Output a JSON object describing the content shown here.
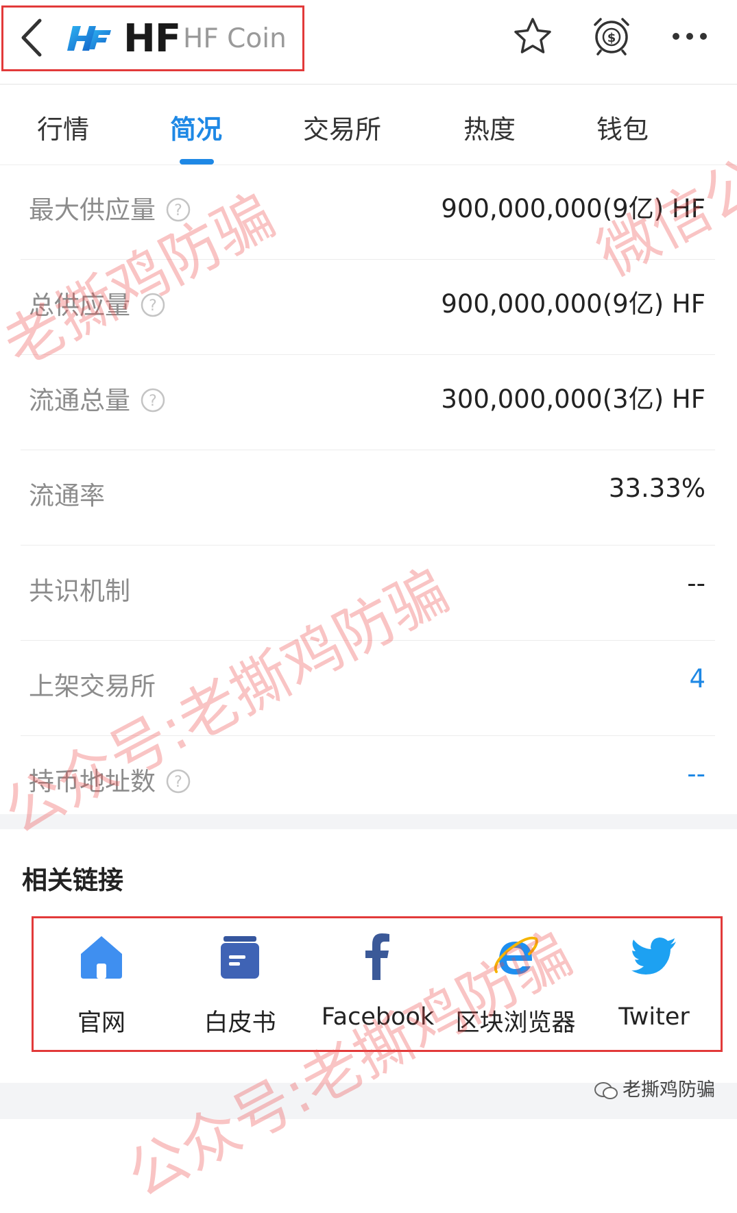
{
  "header": {
    "symbol": "HF",
    "name": "HF Coin"
  },
  "tabs": [
    {
      "label": "行情",
      "active": false
    },
    {
      "label": "简况",
      "active": true
    },
    {
      "label": "交易所",
      "active": false
    },
    {
      "label": "热度",
      "active": false
    },
    {
      "label": "钱包",
      "active": false
    }
  ],
  "rows": [
    {
      "label": "最大供应量",
      "value": "900,000,000(9亿) HF",
      "help": true
    },
    {
      "label": "总供应量",
      "value": "900,000,000(9亿) HF",
      "help": true
    },
    {
      "label": "流通总量",
      "value": "300,000,000(3亿) HF",
      "help": true
    },
    {
      "label": "流通率",
      "value": "33.33%",
      "help": false
    },
    {
      "label": "共识机制",
      "value": "--",
      "help": false
    },
    {
      "label": "上架交易所",
      "value": "4",
      "help": false,
      "link": true
    },
    {
      "label": "持币地址数",
      "value": "--",
      "help": true,
      "link": true
    }
  ],
  "links": {
    "title": "相关链接",
    "items": [
      {
        "label": "官网",
        "icon": "home-icon"
      },
      {
        "label": "白皮书",
        "icon": "whitepaper-icon"
      },
      {
        "label": "Facebook",
        "icon": "facebook-icon"
      },
      {
        "label": "区块浏览器",
        "icon": "browser-icon"
      },
      {
        "label": "Twiter",
        "icon": "twitter-icon"
      }
    ]
  },
  "watermark": {
    "text_1": "老撕鸡防骗",
    "text_2": "微信公",
    "text_3": "公众号:老撕鸡防骗",
    "text_4": "公众号:老撕鸡防骗",
    "source": "老撕鸡防骗"
  },
  "colors": {
    "accent": "#1e88e5",
    "highlight_border": "#e23a3a",
    "label_gray": "#8c8c8c"
  }
}
